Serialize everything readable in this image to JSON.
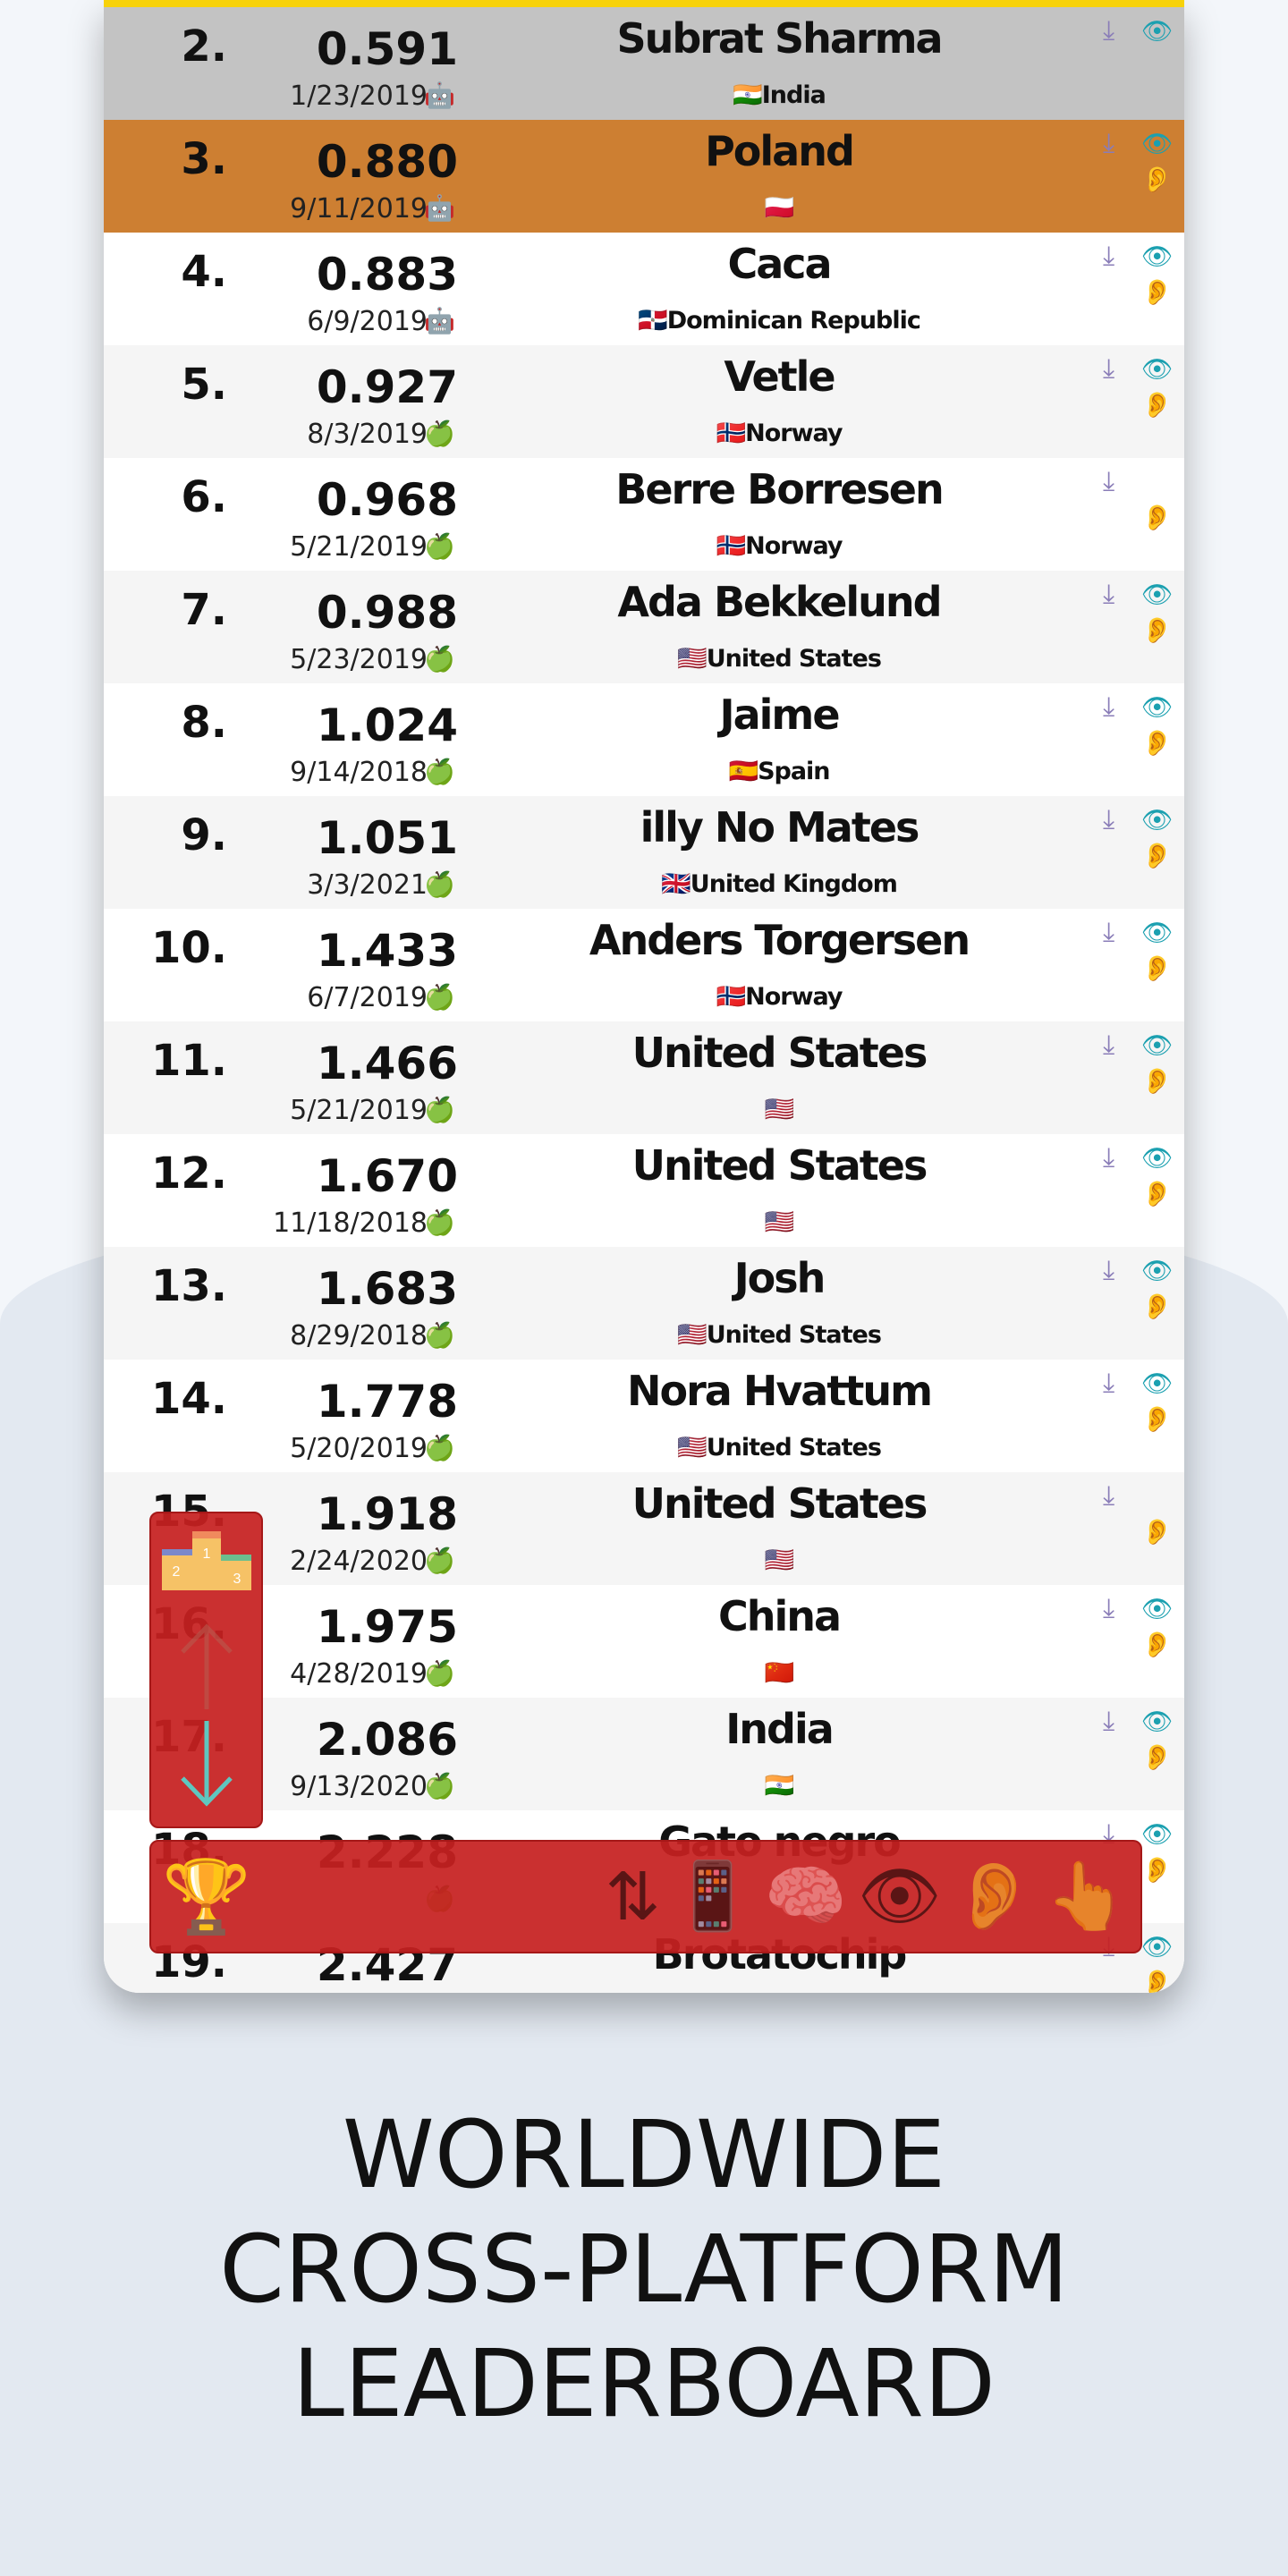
{
  "colors": {
    "gold": "#f7d20a",
    "silver": "#c3c3c3",
    "bronze": "#cd7f32",
    "toolbar": "#c62828"
  },
  "rows": [
    {
      "rank": "2.",
      "score": "0.591",
      "date": "1/23/2019",
      "platform": "android",
      "name": "Subrat Sharma",
      "flag": "🇮🇳",
      "country": "India",
      "eye": true,
      "ear": false,
      "style": "silver"
    },
    {
      "rank": "3.",
      "score": "0.880",
      "date": "9/11/2019",
      "platform": "android",
      "name": "Poland",
      "flag": "🇵🇱",
      "country": "",
      "eye": true,
      "ear": true,
      "style": "bronze"
    },
    {
      "rank": "4.",
      "score": "0.883",
      "date": "6/9/2019",
      "platform": "android",
      "name": "Caca",
      "flag": "🇩🇴",
      "country": "Dominican Republic",
      "eye": true,
      "ear": true,
      "style": ""
    },
    {
      "rank": "5.",
      "score": "0.927",
      "date": "8/3/2019",
      "platform": "apple",
      "name": "Vetle",
      "flag": "🇳🇴",
      "country": "Norway",
      "eye": true,
      "ear": true,
      "style": "alt"
    },
    {
      "rank": "6.",
      "score": "0.968",
      "date": "5/21/2019",
      "platform": "apple",
      "name": "Berre Borresen",
      "flag": "🇳🇴",
      "country": "Norway",
      "eye": false,
      "ear": true,
      "style": ""
    },
    {
      "rank": "7.",
      "score": "0.988",
      "date": "5/23/2019",
      "platform": "apple",
      "name": "Ada Bekkelund",
      "flag": "🇺🇸",
      "country": "United States",
      "eye": true,
      "ear": true,
      "style": "alt"
    },
    {
      "rank": "8.",
      "score": "1.024",
      "date": "9/14/2018",
      "platform": "apple",
      "name": "Jaime",
      "flag": "🇪🇸",
      "country": "Spain",
      "eye": true,
      "ear": true,
      "style": ""
    },
    {
      "rank": "9.",
      "score": "1.051",
      "date": "3/3/2021",
      "platform": "apple",
      "name": "illy No Mates",
      "flag": "🇬🇧",
      "country": "United Kingdom",
      "eye": true,
      "ear": true,
      "style": "alt"
    },
    {
      "rank": "10.",
      "score": "1.433",
      "date": "6/7/2019",
      "platform": "apple",
      "name": "Anders Torgersen",
      "flag": "🇳🇴",
      "country": "Norway",
      "eye": true,
      "ear": true,
      "style": ""
    },
    {
      "rank": "11.",
      "score": "1.466",
      "date": "5/21/2019",
      "platform": "apple",
      "name": "United States",
      "flag": "🇺🇸",
      "country": "",
      "eye": true,
      "ear": true,
      "style": "alt"
    },
    {
      "rank": "12.",
      "score": "1.670",
      "date": "11/18/2018",
      "platform": "apple",
      "name": "United States",
      "flag": "🇺🇸",
      "country": "",
      "eye": true,
      "ear": true,
      "style": ""
    },
    {
      "rank": "13.",
      "score": "1.683",
      "date": "8/29/2018",
      "platform": "apple",
      "name": "Josh",
      "flag": "🇺🇸",
      "country": "United States",
      "eye": true,
      "ear": true,
      "style": "alt"
    },
    {
      "rank": "14.",
      "score": "1.778",
      "date": "5/20/2019",
      "platform": "apple",
      "name": "Nora Hvattum",
      "flag": "🇺🇸",
      "country": "United States",
      "eye": true,
      "ear": true,
      "style": ""
    },
    {
      "rank": "15.",
      "score": "1.918",
      "date": "2/24/2020",
      "platform": "apple",
      "name": "United States",
      "flag": "🇺🇸",
      "country": "",
      "eye": false,
      "ear": true,
      "style": "alt"
    },
    {
      "rank": "16.",
      "score": "1.975",
      "date": "4/28/2019",
      "platform": "apple",
      "name": "China",
      "flag": "🇨🇳",
      "country": "",
      "eye": true,
      "ear": true,
      "style": ""
    },
    {
      "rank": "17.",
      "score": "2.086",
      "date": "9/13/2020",
      "platform": "apple",
      "name": "India",
      "flag": "🇮🇳",
      "country": "",
      "eye": true,
      "ear": true,
      "style": "alt"
    },
    {
      "rank": "18.",
      "score": "2.228",
      "date": "",
      "platform": "apple",
      "name": "Gato negro",
      "flag": "",
      "country": "",
      "eye": true,
      "ear": true,
      "style": ""
    },
    {
      "rank": "19.",
      "score": "2.427",
      "date": "",
      "platform": "",
      "name": "Brotatochip",
      "flag": "",
      "country": "",
      "eye": true,
      "ear": true,
      "style": "alt"
    }
  ],
  "side_panel": {
    "icons": [
      "podium-icon",
      "arrow-up-icon",
      "arrow-down-icon"
    ],
    "podium_numbers": [
      "1",
      "2",
      "3"
    ]
  },
  "toolbar": {
    "icons": [
      "trophy-icon",
      "sort-icon",
      "devices-icon",
      "brain-icon",
      "eye-icon",
      "ear-icon",
      "touch-icon"
    ]
  },
  "headline": {
    "line1": "WORLDWIDE",
    "line2": "CROSS-PLATFORM",
    "line3": "LEADERBOARD"
  }
}
